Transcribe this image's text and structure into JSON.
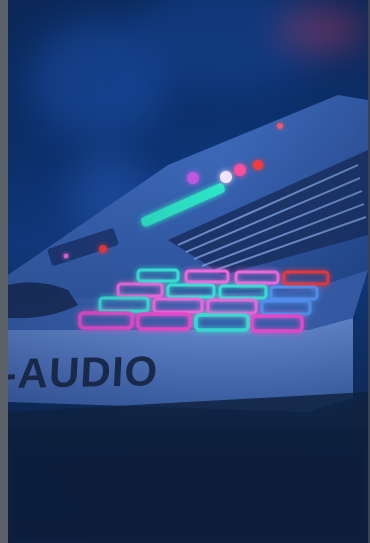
{
  "photo": {
    "subject_icon": "midi-keyboard-icon",
    "brand_text": "-AUDIO",
    "colors": {
      "background_blue": "#0d3576",
      "pad_pink": "#ff4fd8",
      "pad_cyan": "#3cf0e0",
      "pad_red": "#ff3a3a",
      "led_teal": "#2fe8c8"
    }
  }
}
